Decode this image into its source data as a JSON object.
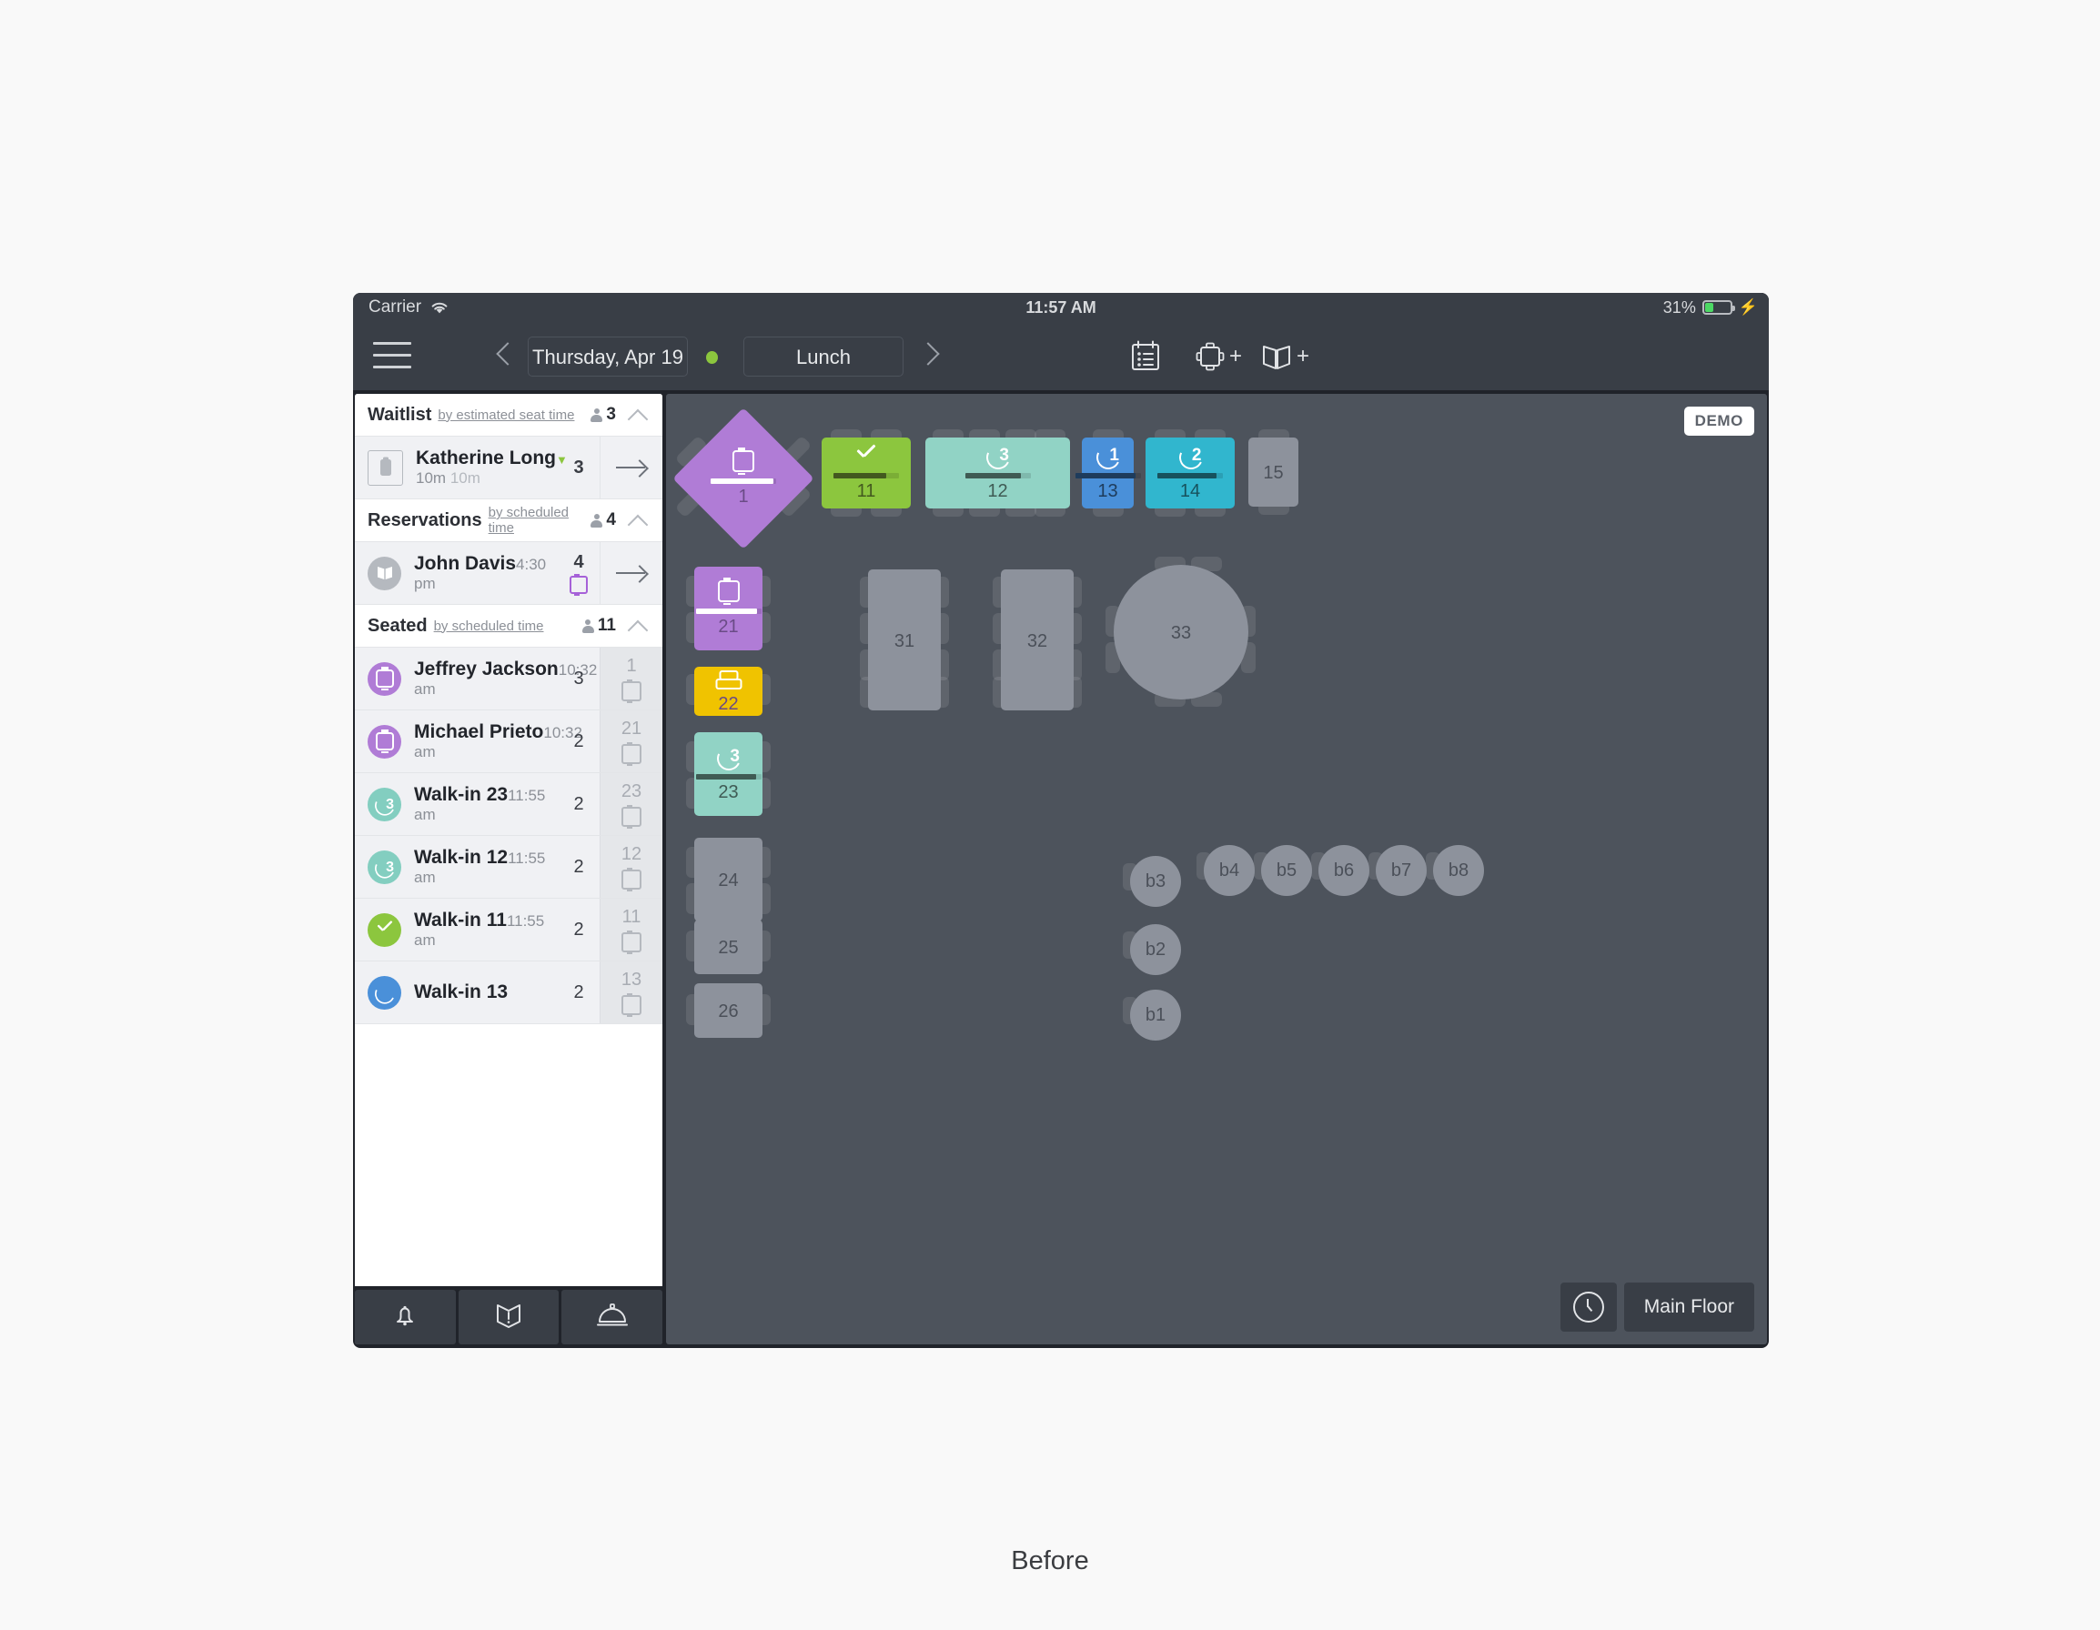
{
  "caption": "Before",
  "status_bar": {
    "carrier": "Carrier",
    "wifi_icon": "wifi-icon",
    "time": "11:57 AM",
    "battery_percent": "31%",
    "battery_level": 31,
    "charging_icon": "bolt-icon"
  },
  "nav": {
    "menu_icon": "hamburger-icon",
    "prev_label": "chevron-left-icon",
    "next_label": "chevron-right-icon",
    "date": "Thursday, Apr 19",
    "shift": "Lunch",
    "status_dot_color": "#8cc63e",
    "list_icon": "clipboard-list-icon",
    "table_icon": "table-add-icon",
    "book_icon": "book-add-icon",
    "plus": "+"
  },
  "sidebar": {
    "sections": [
      {
        "title": "Waitlist",
        "sort": "by estimated seat time",
        "count": "3",
        "collapse_icon": "chevron-up-icon",
        "rows": [
          {
            "name": "Katherine Long",
            "time": "10m",
            "time_prefix": "▼",
            "time_extra": "10m",
            "guests": "3",
            "badge": "clipboard-icon",
            "badge_style": "square",
            "badge_color": "#ffffff",
            "action": "arrow-right-icon"
          }
        ]
      },
      {
        "title": "Reservations",
        "sort": "by scheduled time",
        "count": "4",
        "collapse_icon": "chevron-up-icon",
        "rows": [
          {
            "name": "John Davis",
            "time": "4:30 pm",
            "guests": "4",
            "badge": "book-icon",
            "badge_style": "circle",
            "badge_color": "#b5b9bf",
            "table_glyph": "purple-table-icon",
            "action": "arrow-right-icon"
          }
        ]
      },
      {
        "title": "Seated",
        "sort": "by scheduled time",
        "count": "11",
        "collapse_icon": "chevron-up-icon",
        "rows": [
          {
            "name": "Jeffrey Jackson",
            "time": "10:32 am",
            "guests": "3",
            "badge": "open-table-icon",
            "badge_style": "circle",
            "badge_color": "#b07cd6",
            "table": "1"
          },
          {
            "name": "Michael Prieto",
            "time": "10:32 am",
            "guests": "2",
            "badge": "open-table-icon",
            "badge_style": "circle",
            "badge_color": "#b07cd6",
            "table": "21"
          },
          {
            "name": "Walk-in 23",
            "time": "11:55 am",
            "guests": "2",
            "badge": "course-timer-icon",
            "badge_style": "circle",
            "badge_color": "#83cec0",
            "badge_text": "3",
            "table": "23"
          },
          {
            "name": "Walk-in 12",
            "time": "11:55 am",
            "guests": "2",
            "badge": "course-timer-icon",
            "badge_style": "circle",
            "badge_color": "#83cec0",
            "badge_text": "3",
            "table": "12"
          },
          {
            "name": "Walk-in 11",
            "time": "11:55 am",
            "guests": "2",
            "badge": "check-icon",
            "badge_style": "circle",
            "badge_color": "#8cc63e",
            "table": "11"
          },
          {
            "name": "Walk-in 13",
            "time": "",
            "guests": "2",
            "badge": "course-timer-icon",
            "badge_style": "circle",
            "badge_color": "#4a90d9",
            "table": "13"
          }
        ]
      }
    ],
    "footer": [
      {
        "icon": "bell-icon",
        "name": "alerts-button"
      },
      {
        "icon": "book-alert-icon",
        "name": "notes-button"
      },
      {
        "icon": "server-dome-icon",
        "name": "service-button"
      }
    ]
  },
  "floor": {
    "demo_badge": "DEMO",
    "history_icon": "clock-icon",
    "floor_name": "Main Floor",
    "tables": [
      {
        "label": "1",
        "shape": "diamond",
        "color": "#b07cd6",
        "icon": "open-table-icon",
        "bar": 96,
        "bar_bg": "#ffffff",
        "bar_fill": "#ffffff"
      },
      {
        "label": "11",
        "shape": "rect",
        "color": "#8cc63e",
        "icon": "check-icon",
        "bar": 80,
        "bar_bg": "#43591f",
        "bar_fill": "#43591f"
      },
      {
        "label": "12",
        "shape": "rect",
        "color": "#91d3c5",
        "icon": "course-timer-icon",
        "icon_text": "3",
        "bar": 85,
        "bar_bg": "#3f5b54",
        "bar_fill": "#3f5b54"
      },
      {
        "label": "13",
        "shape": "rect",
        "color": "#4a90d9",
        "icon": "course-timer-icon",
        "icon_text": "1",
        "bar": 92,
        "bar_bg": "#1e3c5c",
        "bar_fill": "#1e3c5c"
      },
      {
        "label": "14",
        "shape": "rect",
        "color": "#31b6ce",
        "icon": "course-timer-icon",
        "icon_text": "2",
        "bar": 90,
        "bar_bg": "#17525d",
        "bar_fill": "#17525d"
      },
      {
        "label": "15",
        "shape": "rect",
        "color": "#8d929c",
        "icon": "",
        "bar": 0
      },
      {
        "label": "21",
        "shape": "rect",
        "color": "#b07cd6",
        "icon": "open-table-icon",
        "bar": 94,
        "bar_bg": "#ffffff",
        "bar_fill": "#ffffff"
      },
      {
        "label": "22",
        "shape": "rect",
        "color": "#f0c300",
        "icon": "dish-icon",
        "bar": 0
      },
      {
        "label": "23",
        "shape": "rect",
        "color": "#91d3c5",
        "icon": "course-timer-icon",
        "icon_text": "3",
        "bar": 92,
        "bar_bg": "#3f5b54",
        "bar_fill": "#3f5b54"
      },
      {
        "label": "24",
        "shape": "rect",
        "color": "#8d929c",
        "icon": "",
        "bar": 0
      },
      {
        "label": "25",
        "shape": "rect",
        "color": "#8d929c",
        "icon": "",
        "bar": 0
      },
      {
        "label": "26",
        "shape": "rect",
        "color": "#8d929c",
        "icon": "",
        "bar": 0
      },
      {
        "label": "31",
        "shape": "rect",
        "color": "#8d929c",
        "icon": "",
        "bar": 0
      },
      {
        "label": "32",
        "shape": "rect",
        "color": "#8d929c",
        "icon": "",
        "bar": 0
      },
      {
        "label": "33",
        "shape": "circle",
        "color": "#8d929c",
        "icon": "",
        "bar": 0
      }
    ],
    "bar_seats": [
      "b1",
      "b2",
      "b3",
      "b4",
      "b5",
      "b6",
      "b7",
      "b8"
    ]
  }
}
